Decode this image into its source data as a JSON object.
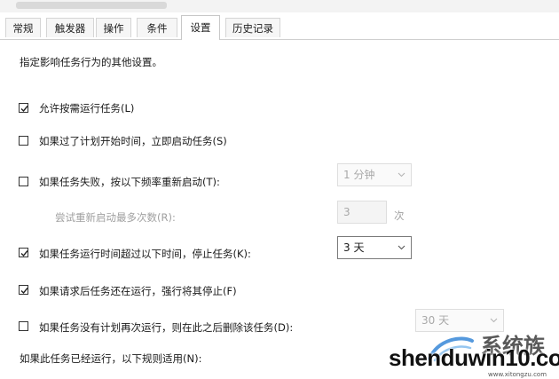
{
  "tabs": [
    {
      "label": "常规"
    },
    {
      "label": "触发器"
    },
    {
      "label": "操作"
    },
    {
      "label": "条件"
    },
    {
      "label": "设置"
    },
    {
      "label": "历史记录"
    }
  ],
  "description": "指定影响任务行为的其他设置。",
  "settings": {
    "allow_on_demand": {
      "label": "允许按需运行任务(L)",
      "checked": true
    },
    "run_asap_after_missed": {
      "label": "如果过了计划开始时间，立即启动任务(S)",
      "checked": false
    },
    "restart_on_failure": {
      "label": "如果任务失败，按以下频率重新启动(T):",
      "checked": false,
      "interval": "1 分钟"
    },
    "restart_attempts": {
      "label": "尝试重新启动最多次数(R):",
      "value": "3",
      "unit": "次"
    },
    "stop_if_runs_longer": {
      "label": "如果任务运行时间超过以下时间，停止任务(K):",
      "checked": true,
      "value": "3 天"
    },
    "force_stop": {
      "label": "如果请求后任务还在运行，强行将其停止(F)",
      "checked": true
    },
    "delete_if_not_scheduled": {
      "label": "如果任务没有计划再次运行，则在此之后删除该任务(D):",
      "checked": false,
      "value": "30 天"
    },
    "already_running_rule": {
      "label": "如果此任务已经运行，以下规则适用(N):"
    }
  },
  "watermark": {
    "text": "shenduwin10.com",
    "cn": "系统族",
    "url": "www.xitongzu.com"
  }
}
